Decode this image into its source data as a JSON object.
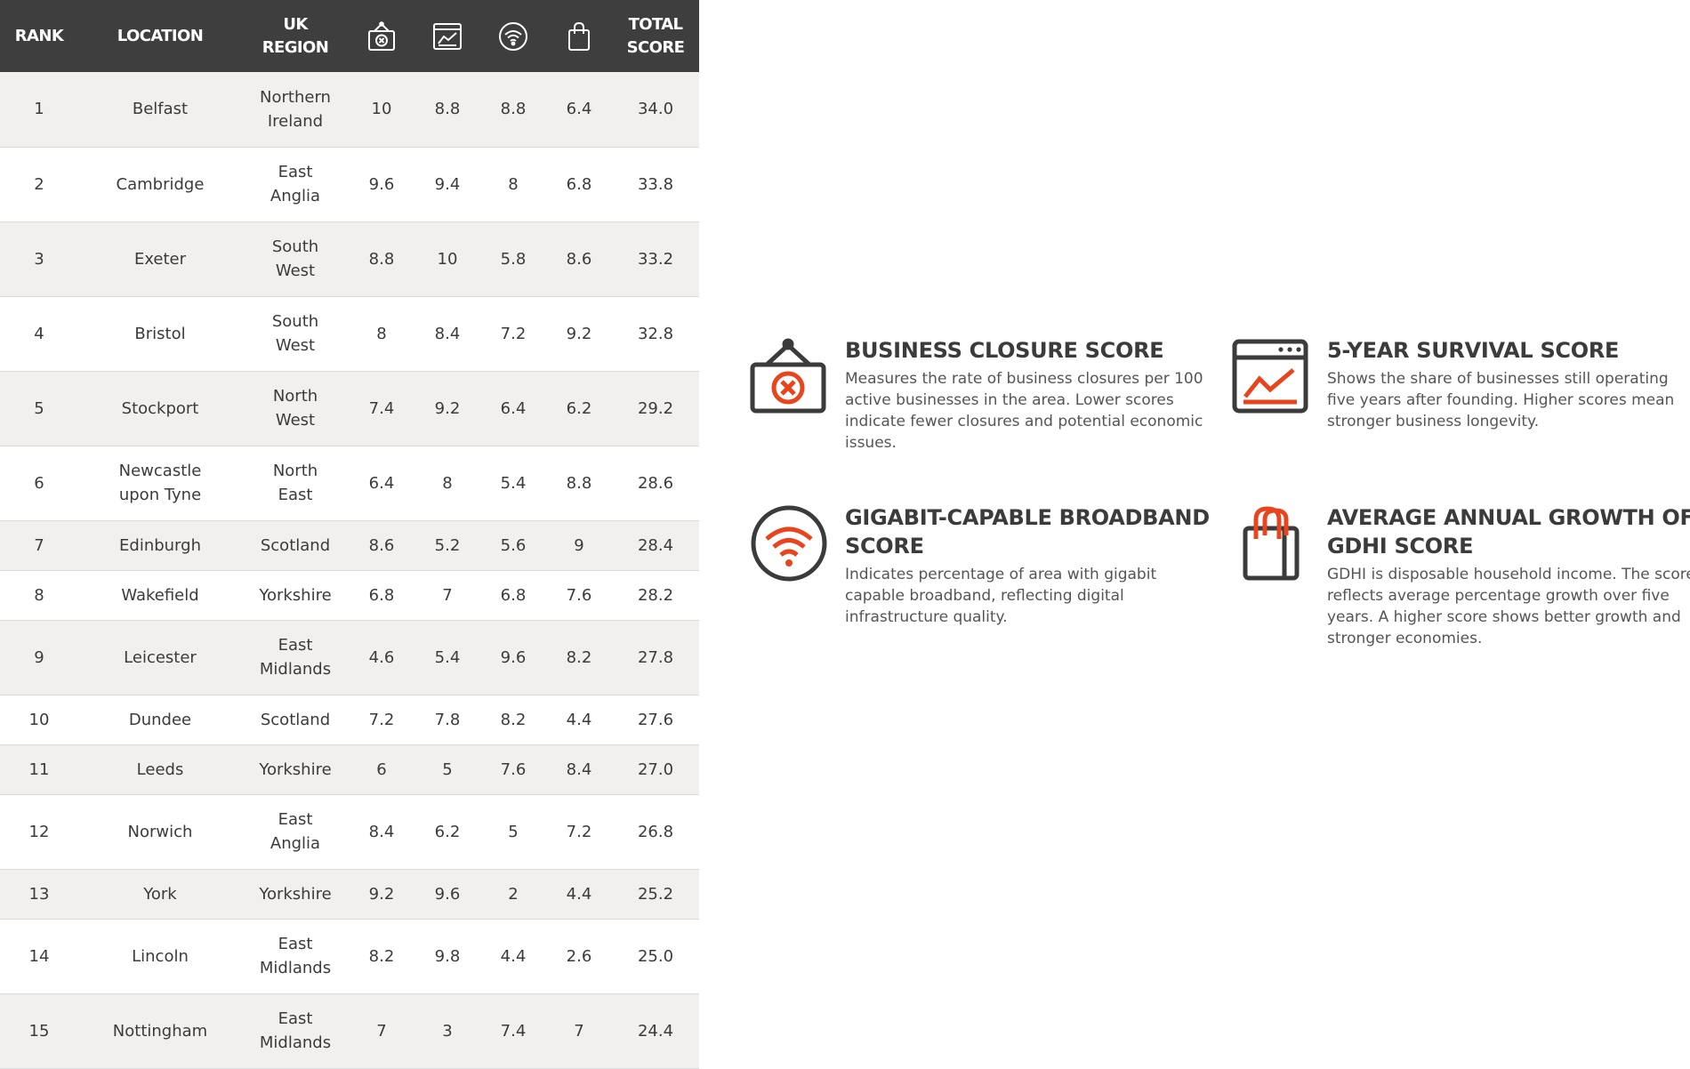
{
  "colors": {
    "header_bg": "#3e3e3e",
    "accent": "#e8441e",
    "icon_dark": "#3b3b3b",
    "row_alt": "#f1f0ee"
  },
  "table": {
    "headers": {
      "rank": "RANK",
      "location": "LOCATION",
      "region_line1": "UK",
      "region_line2": "REGION",
      "closure_icon": "closed-sign-icon",
      "survival_icon": "growth-chart-icon",
      "broadband_icon": "wifi-icon",
      "gdhi_icon": "shopping-bag-icon",
      "total_line1": "TOTAL",
      "total_line2": "SCORE"
    },
    "rows": [
      {
        "rank": "1",
        "location": "Belfast",
        "region": "Northern Ireland",
        "closure": "10",
        "survival": "8.8",
        "broadband": "8.8",
        "gdhi": "6.4",
        "total": "34.0"
      },
      {
        "rank": "2",
        "location": "Cambridge",
        "region": "East Anglia",
        "closure": "9.6",
        "survival": "9.4",
        "broadband": "8",
        "gdhi": "6.8",
        "total": "33.8"
      },
      {
        "rank": "3",
        "location": "Exeter",
        "region": "South West",
        "closure": "8.8",
        "survival": "10",
        "broadband": "5.8",
        "gdhi": "8.6",
        "total": "33.2"
      },
      {
        "rank": "4",
        "location": "Bristol",
        "region": "South West",
        "closure": "8",
        "survival": "8.4",
        "broadband": "7.2",
        "gdhi": "9.2",
        "total": "32.8"
      },
      {
        "rank": "5",
        "location": "Stockport",
        "region": "North West",
        "closure": "7.4",
        "survival": "9.2",
        "broadband": "6.4",
        "gdhi": "6.2",
        "total": "29.2"
      },
      {
        "rank": "6",
        "location": "Newcastle upon Tyne",
        "region": "North East",
        "closure": "6.4",
        "survival": "8",
        "broadband": "5.4",
        "gdhi": "8.8",
        "total": "28.6"
      },
      {
        "rank": "7",
        "location": "Edinburgh",
        "region": "Scotland",
        "closure": "8.6",
        "survival": "5.2",
        "broadband": "5.6",
        "gdhi": "9",
        "total": "28.4"
      },
      {
        "rank": "8",
        "location": "Wakefield",
        "region": "Yorkshire",
        "closure": "6.8",
        "survival": "7",
        "broadband": "6.8",
        "gdhi": "7.6",
        "total": "28.2"
      },
      {
        "rank": "9",
        "location": "Leicester",
        "region": "East Midlands",
        "closure": "4.6",
        "survival": "5.4",
        "broadband": "9.6",
        "gdhi": "8.2",
        "total": "27.8"
      },
      {
        "rank": "10",
        "location": "Dundee",
        "region": "Scotland",
        "closure": "7.2",
        "survival": "7.8",
        "broadband": "8.2",
        "gdhi": "4.4",
        "total": "27.6"
      },
      {
        "rank": "11",
        "location": "Leeds",
        "region": "Yorkshire",
        "closure": "6",
        "survival": "5",
        "broadband": "7.6",
        "gdhi": "8.4",
        "total": "27.0"
      },
      {
        "rank": "12",
        "location": "Norwich",
        "region": "East Anglia",
        "closure": "8.4",
        "survival": "6.2",
        "broadband": "5",
        "gdhi": "7.2",
        "total": "26.8"
      },
      {
        "rank": "13",
        "location": "York",
        "region": "Yorkshire",
        "closure": "9.2",
        "survival": "9.6",
        "broadband": "2",
        "gdhi": "4.4",
        "total": "25.2"
      },
      {
        "rank": "14",
        "location": "Lincoln",
        "region": "East Midlands",
        "closure": "8.2",
        "survival": "9.8",
        "broadband": "4.4",
        "gdhi": "2.6",
        "total": "25.0"
      },
      {
        "rank": "15",
        "location": "Nottingham",
        "region": "East Midlands",
        "closure": "7",
        "survival": "3",
        "broadband": "7.4",
        "gdhi": "7",
        "total": "24.4"
      }
    ]
  },
  "legend": {
    "closure": {
      "icon": "closed-sign-icon",
      "title": "BUSINESS CLOSURE SCORE",
      "desc": "Measures the rate of business closures per 100 active businesses in the area. Lower scores indicate fewer closures and potential economic issues."
    },
    "survival": {
      "icon": "growth-chart-icon",
      "title": "5-YEAR SURVIVAL SCORE",
      "desc": "Shows the share of businesses still operating five years after founding. Higher scores mean stronger business longevity."
    },
    "broadband": {
      "icon": "wifi-icon",
      "title": "GIGABIT-CAPABLE BROADBAND SCORE",
      "desc": "Indicates percentage of area with gigabit capable broadband, reflecting digital infrastructure quality."
    },
    "gdhi": {
      "icon": "shopping-bag-icon",
      "title": "AVERAGE ANNUAL GROWTH OF GDHI SCORE",
      "desc": "GDHI is disposable household income. The score reflects average percentage growth over five years. A higher score shows better growth and stronger economies."
    }
  }
}
